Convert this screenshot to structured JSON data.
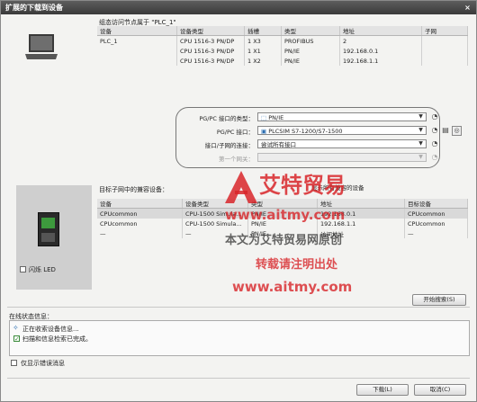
{
  "window": {
    "title": "扩展的下载到设备",
    "close_label": "×"
  },
  "config_nodes": {
    "title": "组态访问节点属于 \"PLC_1\"",
    "columns": [
      "设备",
      "设备类型",
      "插槽",
      "类型",
      "地址",
      "子网"
    ],
    "rows": [
      [
        "PLC_1",
        "CPU 1516-3 PN/DP",
        "1 X3",
        "PROFIBUS",
        "2",
        ""
      ],
      [
        "",
        "CPU 1516-3 PN/DP",
        "1 X1",
        "PN/IE",
        "192.168.0.1",
        ""
      ],
      [
        "",
        "CPU 1516-3 PN/DP",
        "1 X2",
        "PN/IE",
        "192.168.1.1",
        ""
      ]
    ]
  },
  "interface": {
    "type_label": "PG/PC 接口的类型：",
    "type_value": "PN/IE",
    "pgpc_label": "PG/PC 接口：",
    "pgpc_value": "PLCSIM S7-1200/S7-1500",
    "conn_label": "接口/子网的连接：",
    "conn_value": "尝试所有接口",
    "gateway_label": "第一个网关：",
    "gateway_value": ""
  },
  "target": {
    "title": "目标子网中的兼容设备：",
    "show_all_label": "显示所有兼容的设备",
    "columns": [
      "设备",
      "设备类型",
      "类型",
      "地址",
      "目标设备"
    ],
    "rows": [
      [
        "CPUcommon",
        "CPU-1500 Simula...",
        "PN/IE",
        "192.168.0.1",
        "CPUcommon"
      ],
      [
        "CPUcommon",
        "CPU-1500 Simula...",
        "PN/IE",
        "192.168.1.1",
        "CPUcommon"
      ],
      [
        "—",
        "—",
        "PN/IE",
        "访问地址",
        "—"
      ]
    ]
  },
  "flash_led_label": "闪烁 LED",
  "start_search_label": "开始搜索(S)",
  "status": {
    "title": "在线状态信息：",
    "lines": [
      "正在收索设备信息...",
      "扫描和信息检索已完成。"
    ]
  },
  "show_errors_label": "仅显示错误消息",
  "load_button": "下载(L)",
  "cancel_button": "取消(C)",
  "watermark": {
    "brand": "艾特贸易",
    "url1": "www.aitmy.com",
    "notice1": "本文为艾特贸易网原创",
    "notice2": "转载请注明出处",
    "url2": "www.aitmy.com"
  }
}
